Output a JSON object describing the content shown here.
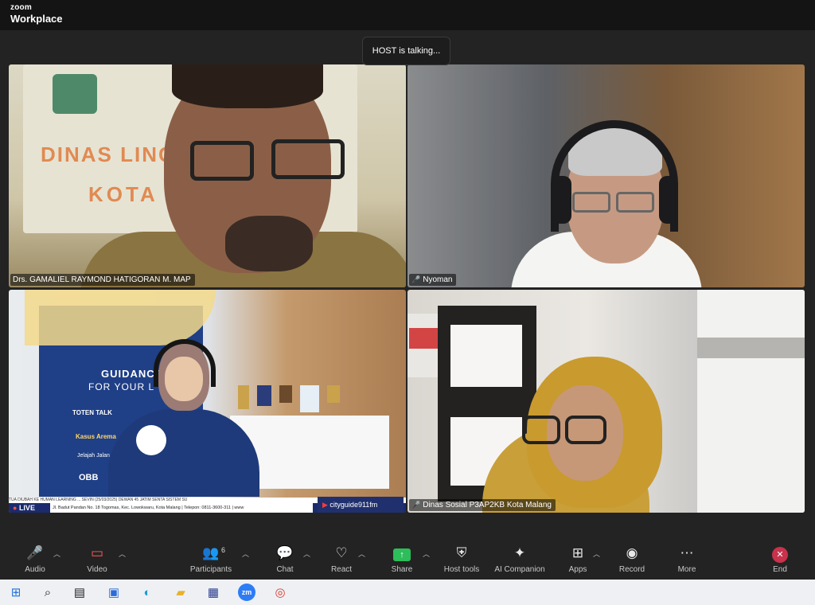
{
  "window": {
    "brand_small": "zoom",
    "brand_big": "Workplace"
  },
  "toast": "HOST is talking...",
  "participants": [
    {
      "name": "Drs. GAMALIEL RAYMOND HATIGORAN M. MAP",
      "sign_line1": "DINAS LING",
      "sign_line2": "KOTA"
    },
    {
      "name": "Nyoman"
    },
    {
      "name": "",
      "live": "LIVE",
      "ticker": "Jl. Badut Pandan No. 18 Togomas, Kec. Lowokwaru, Kota Malang | Telepon: 0811-3600-311 | www",
      "ticker_top": "TUA DIUBAH KE HUMAN LEARNING ... SEVIN (25/03/2025) DEWAN 45 JATIM SENTA SISTEM SU",
      "channel": "cityguide911fm",
      "banner_title": "GUIDANCE",
      "banner_sub": "FOR YOUR L",
      "banner_items": [
        "TOTEN TALK",
        "Kasus Arema",
        "Jelajah Jalan Flux",
        "OBB"
      ]
    },
    {
      "name": "Dinas Sosial P3AP2KB Kota Malang"
    }
  ],
  "toolbar": {
    "audio": "Audio",
    "video": "Video",
    "participants": "Participants",
    "participants_count": "6",
    "chat": "Chat",
    "react": "React",
    "share": "Share",
    "host_tools": "Host tools",
    "ai_companion": "AI Companion",
    "apps": "Apps",
    "record": "Record",
    "more": "More",
    "end": "End"
  },
  "colors": {
    "share_green": "#2dbd5a",
    "end_red": "#c8324b",
    "mic_off": "#ff5b5b"
  },
  "taskbar_icons": [
    "windows-icon",
    "search-icon",
    "task-view-icon",
    "store-icon",
    "edge-icon",
    "file-explorer-icon",
    "app-icon",
    "zoom-icon",
    "chrome-icon"
  ]
}
